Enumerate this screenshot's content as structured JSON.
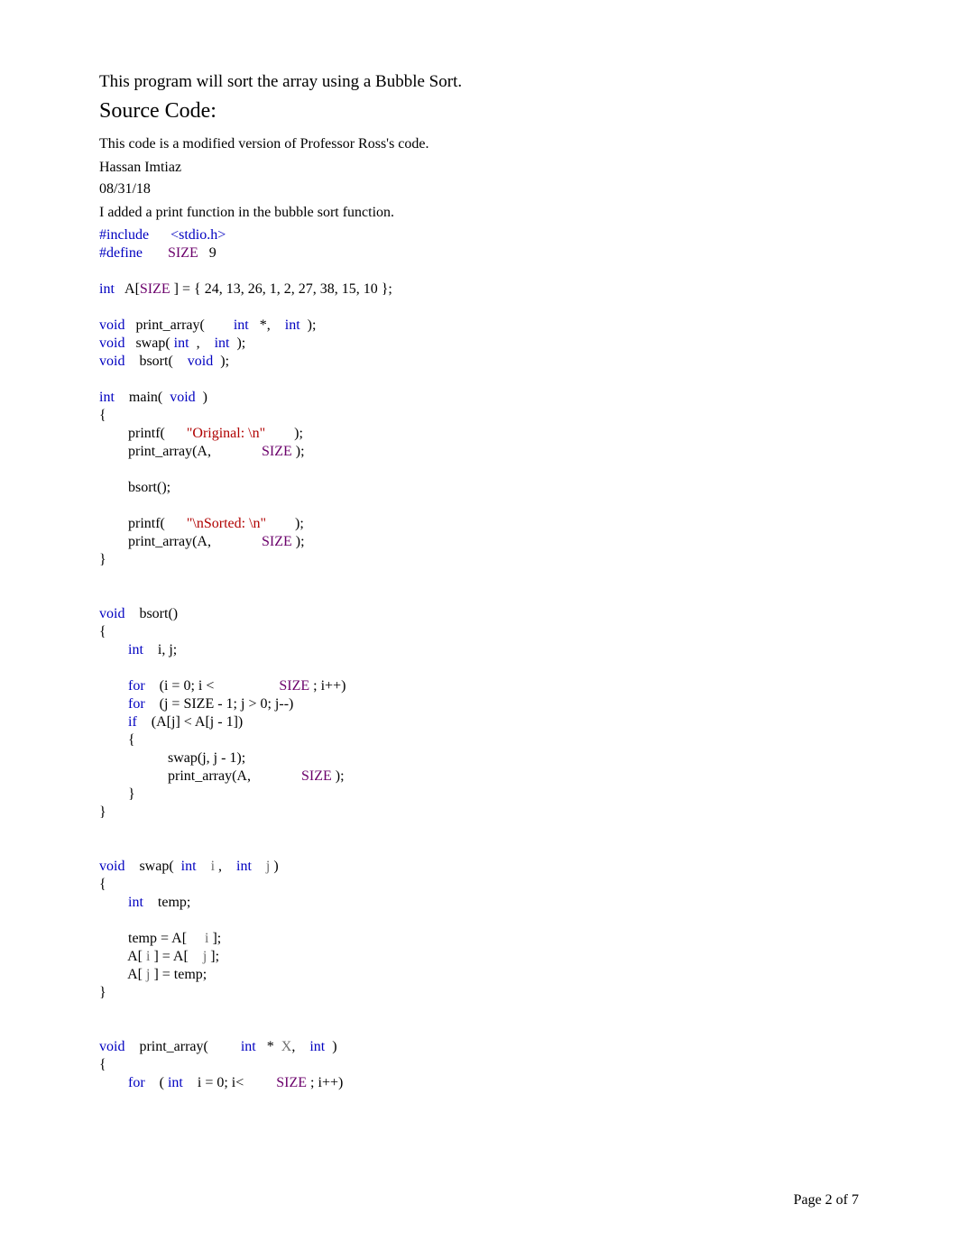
{
  "header": {
    "description": "This program will sort the array using a Bubble Sort.",
    "section_title": "Source Code:"
  },
  "meta": {
    "line1": "This code is a modified version of Professor Ross's code.",
    "author": "Hassan Imtiaz",
    "date": "08/31/18",
    "note": "I added a print function in the bubble sort function."
  },
  "code": {
    "l01a": "#include",
    "l01b": "<stdio.h>",
    "l02a": "#define",
    "l02b": "SIZE",
    "l02c": "9",
    "l04a": "int",
    "l04b": "   A[",
    "l04c": "SIZE",
    "l04d": " ] = { 24, 13, 26, 1, 2, 27, 38, 15, 10 };",
    "l06a": "void",
    "l06b": "   print_array(        ",
    "l06c": "int",
    "l06d": "   *,    ",
    "l06e": "int",
    "l06f": "  );",
    "l07a": "void",
    "l07b": "   swap( ",
    "l07c": "int",
    "l07d": "  ,    ",
    "l07e": "int",
    "l07f": "  );",
    "l08a": "void",
    "l08b": "    bsort(    ",
    "l08c": "void",
    "l08d": "  );",
    "l10a": "int",
    "l10b": "    main(  ",
    "l10c": "void",
    "l10d": "  )",
    "l11": "{",
    "l12a": "        printf(      ",
    "l12b": "\"Original: \\n\"",
    "l12c": "        );",
    "l13a": "        print_array(A,              ",
    "l13b": "SIZE",
    "l13c": " );",
    "l15": "        bsort();",
    "l17a": "        printf(      ",
    "l17b": "\"\\nSorted: \\n\"",
    "l17c": "        );",
    "l18a": "        print_array(A,              ",
    "l18b": "SIZE",
    "l18c": " );",
    "l19": "}",
    "l22a": "void",
    "l22b": "    bsort()",
    "l23": "{",
    "l24a": "        ",
    "l24b": "int",
    "l24c": "    i, j;",
    "l26a": "        ",
    "l26b": "for",
    "l26c": "    (i = 0; i <                  ",
    "l26d": "SIZE",
    "l26e": " ; i++)",
    "l27a": "        ",
    "l27b": "for",
    "l27c": "    (j = SIZE - 1; j > 0; j--)",
    "l28a": "        ",
    "l28b": "if",
    "l28c": "    (A[j] < A[j - 1])",
    "l29": "        {",
    "l30": "                   swap(j, j - 1);",
    "l31a": "                   print_array(A,              ",
    "l31b": "SIZE",
    "l31c": " );",
    "l32": "        }",
    "l33": "}",
    "l36a": "void",
    "l36b": "    swap(  ",
    "l36c": "int",
    "l36d": "    ",
    "l36e": "i",
    "l36f": " ,    ",
    "l36g": "int",
    "l36h": "    ",
    "l36i": "j",
    "l36j": " )",
    "l37": "{",
    "l38a": "        ",
    "l38b": "int",
    "l38c": "    temp;",
    "l40a": "        temp = A[     ",
    "l40b": "i",
    "l40c": " ];",
    "l41a": "        A[ ",
    "l41b": "i",
    "l41c": " ] = A[    ",
    "l41d": "j",
    "l41e": " ];",
    "l42a": "        A[ ",
    "l42b": "j",
    "l42c": " ] = temp;",
    "l43": "}",
    "l46a": "void",
    "l46b": "    print_array(         ",
    "l46c": "int",
    "l46d": "   *  ",
    "l46e": "X",
    "l46f": ",    ",
    "l46g": "int",
    "l46h": "  )",
    "l47": "{",
    "l48a": "        ",
    "l48b": "for",
    "l48c": "    ( ",
    "l48d": "int",
    "l48e": "    i = 0; i<         ",
    "l48f": "SIZE",
    "l48g": " ; i++)"
  },
  "footer": {
    "page_label": "Page",
    "current": "2",
    "of_label": "of",
    "total": "7"
  }
}
